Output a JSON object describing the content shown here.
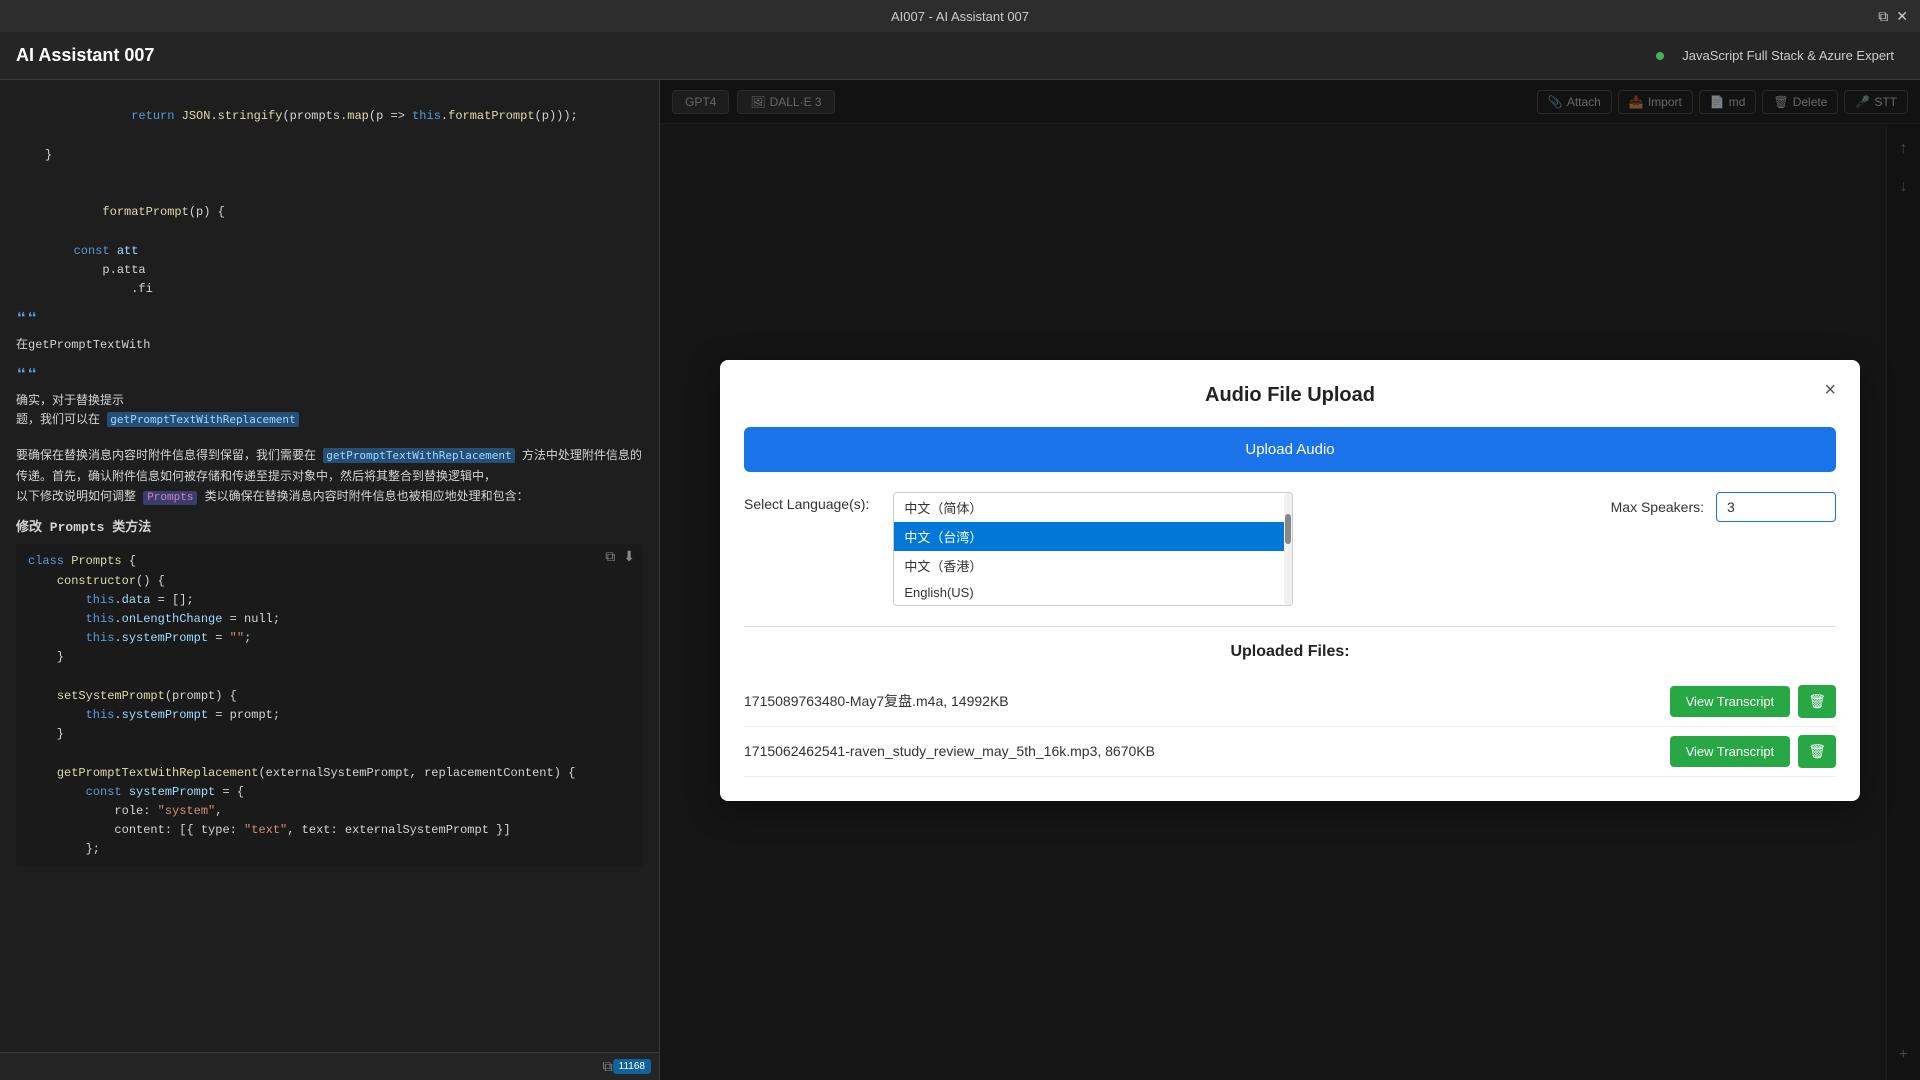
{
  "titleBar": {
    "title": "AI007 - AI Assistant 007",
    "icons": [
      "duplicate-icon",
      "close-icon"
    ]
  },
  "appHeader": {
    "title": "AI Assistant 007",
    "statusLabel": "JavaScript Full Stack & Azure Expert",
    "statusColor": "#4caf50"
  },
  "rightToolbar": {
    "tabs": [
      {
        "id": "gpt4",
        "label": "GPT4",
        "active": false
      },
      {
        "id": "dalle3",
        "label": "DALL·E 3",
        "active": false
      }
    ],
    "buttons": [
      {
        "id": "attach",
        "label": "Attach",
        "icon": "📎"
      },
      {
        "id": "import",
        "label": "Import",
        "icon": "📥"
      },
      {
        "id": "md",
        "label": "md",
        "icon": "📄"
      },
      {
        "id": "delete",
        "label": "Delete",
        "icon": "🗑"
      },
      {
        "id": "stt",
        "label": "STT",
        "icon": "🎤"
      }
    ]
  },
  "modal": {
    "title": "Audio File Upload",
    "closeLabel": "×",
    "uploadButtonLabel": "Upload Audio",
    "languageSelectLabel": "Select Language(s):",
    "languages": [
      {
        "value": "zh-cn",
        "label": "中文（简体）",
        "selected": false
      },
      {
        "value": "zh-tw",
        "label": "中文（台湾）",
        "selected": true
      },
      {
        "value": "zh-hk",
        "label": "中文（香港）",
        "selected": false
      },
      {
        "value": "en-us",
        "label": "English(US)",
        "selected": false
      }
    ],
    "maxSpeakersLabel": "Max Speakers:",
    "maxSpeakersValue": "3",
    "uploadedFilesTitle": "Uploaded Files:",
    "files": [
      {
        "id": "file1",
        "name": "1715089763480-May7复盘.m4a, 14992KB",
        "viewTranscriptLabel": "View Transcript",
        "deleteLabel": "🗑"
      },
      {
        "id": "file2",
        "name": "1715062462541-raven_study_review_may_5th_16k.mp3, 8670KB",
        "viewTranscriptLabel": "View Transcript",
        "deleteLabel": "🗑"
      }
    ]
  },
  "codeEditor": {
    "lines": [
      "        return JSON.stringify(prompts.map(p => this.formatPrompt(p)));",
      "    }",
      "",
      "    formatPrompt(p) {",
      "        const att",
      "            p.atta",
      "            .fi"
    ],
    "chineseSection1": {
      "text": "在getPromptTextWith"
    },
    "chineseSection2": {
      "text": "确实，对于替换提示",
      "text2": "题，我们可以在 'ge"
    },
    "chineseBlock": {
      "heading": "修改 Prompts 类方法",
      "intro": "要确保在替换消息内容时附件信息得到保留，我们需要在",
      "highlight": "getPromptTextWithReplacement",
      "intro2": "方法中处理附件信息的传递。首先，确认附件信息如何被存储和传递至提示对象中，然后将其整合到替换逻辑中，以下修改说明如何调整",
      "promptsHighlight": "Prompts",
      "intro3": "类以确保在替换消息内容时附件信息也被相应地处理和包含："
    },
    "classCode": [
      "class Prompts {",
      "    constructor() {",
      "        this.data = [];",
      "        this.onLengthChange = null;",
      "        this.systemPrompt = \"\";",
      "    }",
      "",
      "    setSystemPrompt(prompt) {",
      "        this.systemPrompt = prompt;",
      "    }",
      "",
      "    getPromptTextWithReplacement(externalSystemPrompt, replacementContent) {",
      "        const systemPrompt = {",
      "            role: \"system\",",
      "            content: [{ type: \"text\", text: externalSystemPrompt }]",
      "        };",
      "    };"
    ],
    "lineCount": "11168",
    "copyIconLabel": "copy"
  }
}
